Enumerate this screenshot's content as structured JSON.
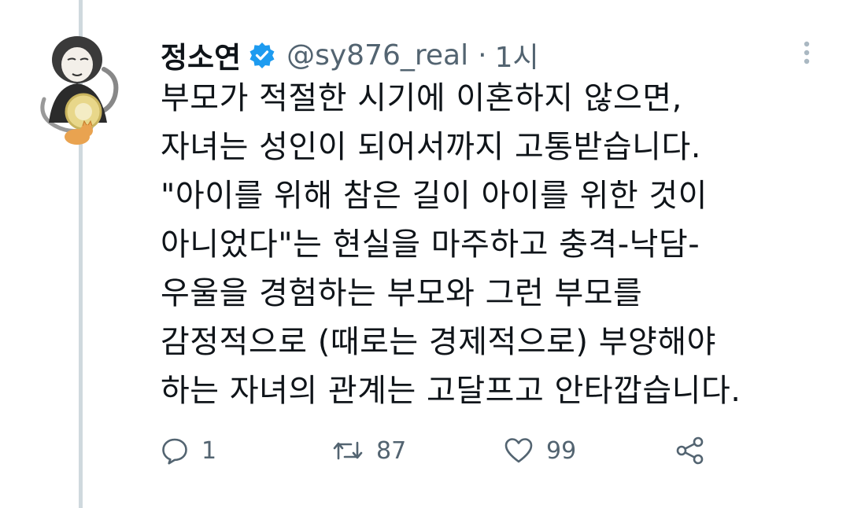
{
  "tweet": {
    "display_name": "정소연",
    "verified": true,
    "handle": "@sy876_real",
    "separator": "·",
    "time": "1시",
    "text_lines": [
      "부모가 적절한 시기에 이혼하지 않으면,",
      "자녀는 성인이 되어서까지 고통받습니다.",
      "\"아이를 위해 참은 길이 아이를 위한 것이",
      "아니었다\"는 현실을 마주하고 충격-낙담-",
      "우울을 경험하는 부모와 그런 부모를",
      "감정적으로 (때로는 경제적으로) 부양해야",
      "하는 자녀의 관계는 고달프고 안타깝습니다."
    ],
    "actions": {
      "reply": {
        "icon": "reply-icon",
        "count": "1"
      },
      "retweet": {
        "icon": "retweet-icon",
        "count": "87"
      },
      "like": {
        "icon": "heart-icon",
        "count": "99"
      },
      "share": {
        "icon": "share-icon"
      }
    }
  },
  "colors": {
    "text": "#0f1419",
    "secondary": "#536471",
    "verified": "#1d9bf0",
    "thread_line": "#cfd9de"
  }
}
